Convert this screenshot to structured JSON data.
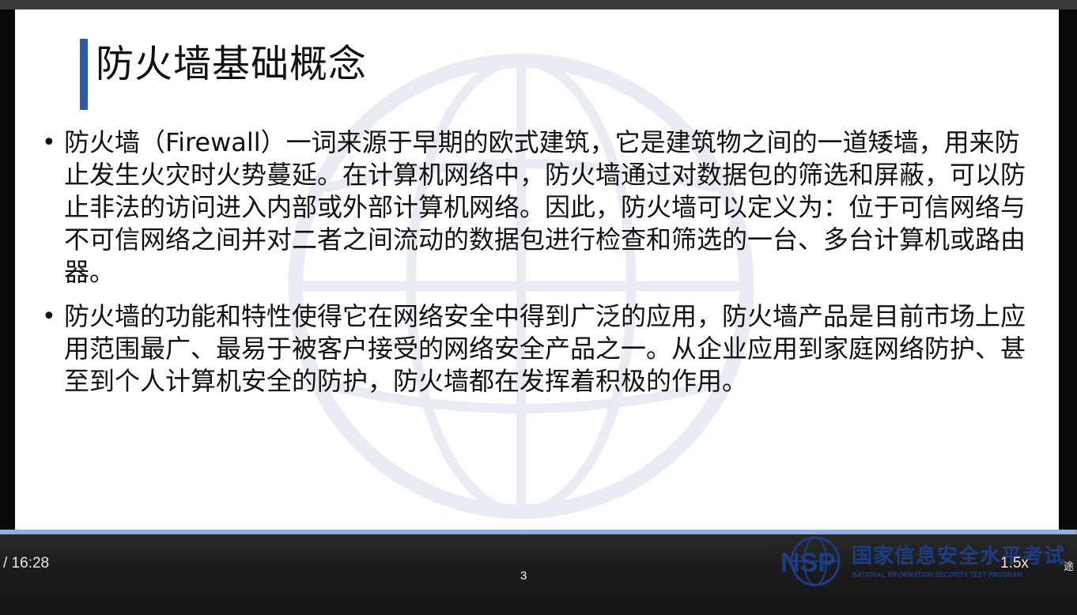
{
  "slide": {
    "title": "防火墙基础概念",
    "bullets": [
      {
        "marker": "•",
        "text": "防火墙（Firewall）一词来源于早期的欧式建筑，它是建筑物之间的一道矮墙，用来防止发生火灾时火势蔓延。在计算机网络中，防火墙通过对数据包的筛选和屏蔽，可以防止非法的访问进入内部或外部计算机网络。因此，防火墙可以定义为：位于可信网络与不可信网络之间并对二者之间流动的数据包进行检查和筛选的一台、多台计算机或路由器。"
      },
      {
        "marker": "•",
        "text": "防火墙的功能和特性使得它在网络安全中得到广泛的应用，防火墙产品是目前市场上应用范围最广、最易于被客户接受的网络安全产品之一。从企业应用到家庭网络防护、甚至到个人计算机安全的防护，防火墙都在发挥着积极的作用。"
      }
    ],
    "page_number": "3",
    "logo": {
      "mark": "NSP",
      "name_cn": "国家信息安全水平考试",
      "name_en": "NATIONAL INFORMATION SECURITY TEST PROGRAM"
    },
    "accent_color": "#2e5aa8"
  },
  "player": {
    "time_display": "/ 16:28",
    "speed_label": "1.5x",
    "quality_label": "途",
    "progress_fraction": 0.999
  }
}
